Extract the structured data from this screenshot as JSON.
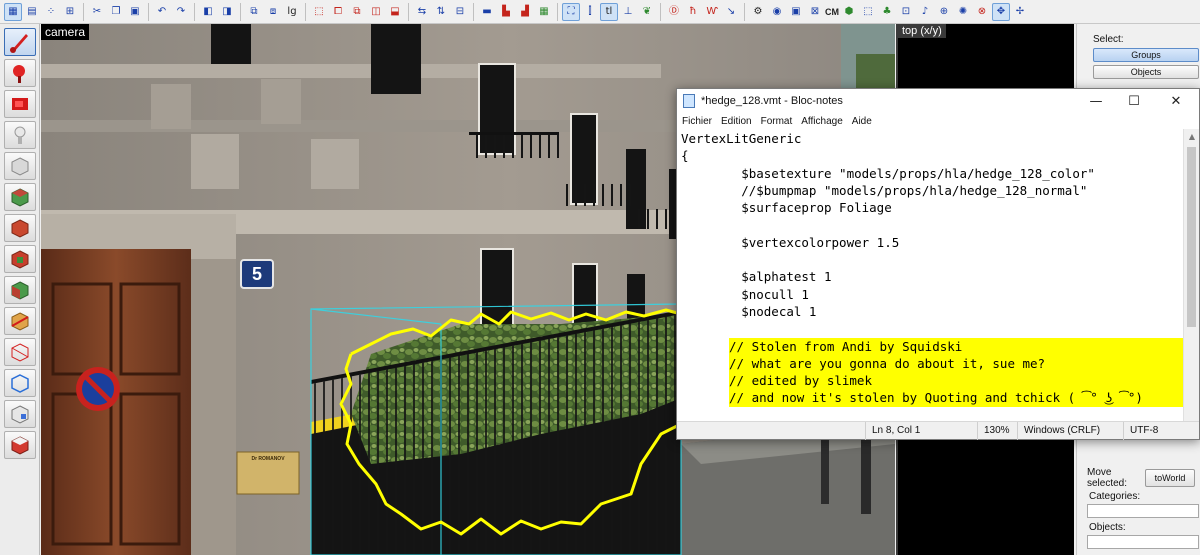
{
  "toolbar": {
    "tool_cm_label": "CM"
  },
  "viewport_camera": {
    "label": "camera",
    "house_number": "5",
    "plaque_text": "Dr ROMANOV"
  },
  "viewport_top": {
    "label": "top (x/y)"
  },
  "side_panel": {
    "select_label": "Select:",
    "groups_button": "Groups",
    "objects_button": "Objects",
    "move_selected_label": "Move selected:",
    "to_world_button": "toWorld",
    "categories_label": "Categories:",
    "objects_label": "Objects:"
  },
  "notepad": {
    "title": "*hedge_128.vmt - Bloc-notes",
    "menu": [
      "Fichier",
      "Edition",
      "Format",
      "Affichage",
      "Aide"
    ],
    "lines": [
      "VertexLitGeneric",
      "{",
      "        $basetexture \"models/props/hla/hedge_128_color\"",
      "        //$bumpmap \"models/props/hla/hedge_128_normal\"",
      "        $surfaceprop Foliage",
      "",
      "        $vertexcolorpower 1.5",
      "",
      "        $alphatest 1",
      "        $nocull 1",
      "        $nodecal 1",
      "",
      "        // Stolen from Andi by Squidski",
      "        // what are you gonna do about it, sue me?",
      "        // edited by slimek",
      "        // and now it's stolen by Quoting and tchick ( ͡° ͜ʖ ͡°)"
    ],
    "highlight_lines": [
      12,
      13,
      14,
      15
    ],
    "status": {
      "position": "Ln 8, Col 1",
      "zoom": "130%",
      "line_ending": "Windows (CRLF)",
      "encoding": "UTF-8"
    }
  },
  "colors": {
    "selection_outline": "#ffff00",
    "bbox_outline": "#33d6e6",
    "comment_highlight": "#ffff00",
    "viewport_bg_top": "#000000"
  }
}
